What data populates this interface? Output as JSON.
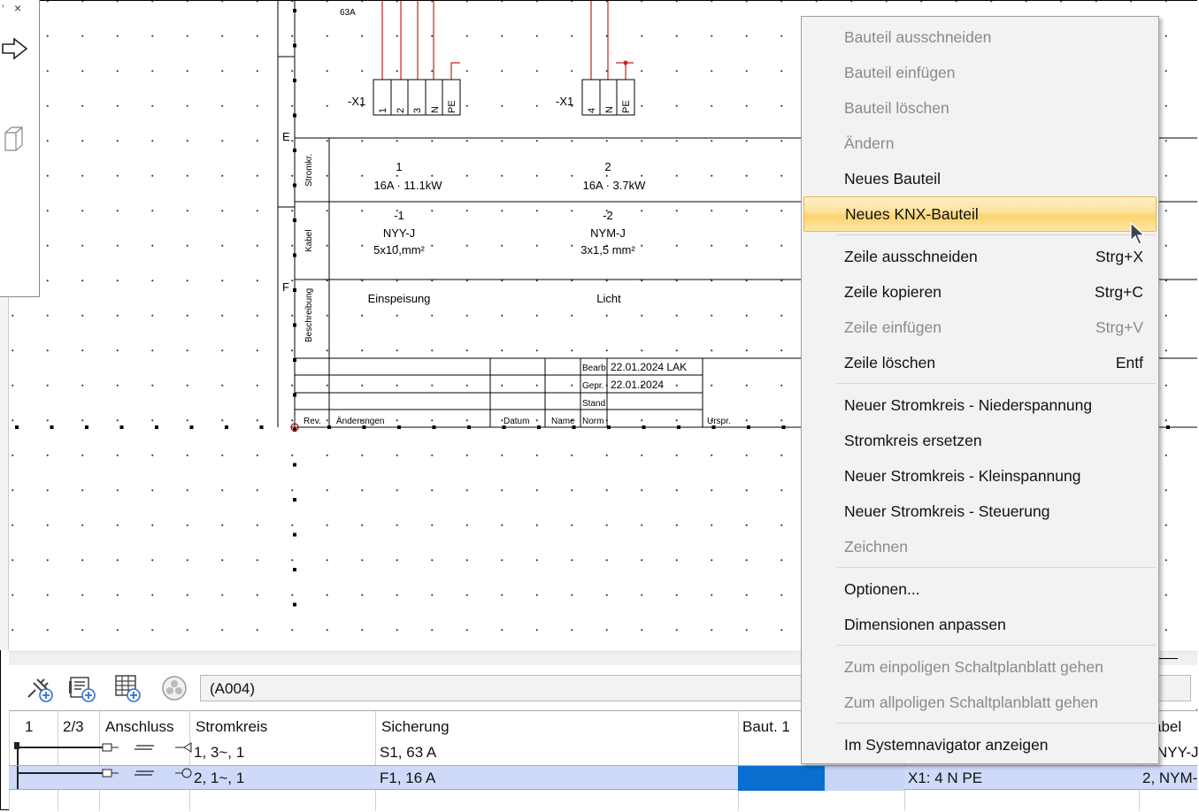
{
  "left_panel": {
    "close_glyph": "×",
    "icons": [
      "arrow-right-icon",
      "cube-icon"
    ]
  },
  "schematic": {
    "top_label": "63A",
    "terminals": [
      {
        "label": "-X1",
        "pins": [
          "1",
          "2",
          "3",
          "N",
          "PE"
        ]
      },
      {
        "label": "-X1",
        "pins": [
          "4",
          "N",
          "PE"
        ]
      }
    ],
    "row_letters": [
      "E",
      "F"
    ],
    "row_headers": [
      "Stromkr.",
      "Kabel",
      "Beschreibung"
    ],
    "circuits": [
      {
        "number": "1",
        "rating": "16A · 11.1kW",
        "cable_id": "-1",
        "cable_type": "NYY-J",
        "cable_size": "5x10,mm²",
        "description": "Einspeisung"
      },
      {
        "number": "2",
        "rating": "16A · 3.7kW",
        "cable_id": "-2",
        "cable_type": "NYM-J",
        "cable_size": "3x1,5 mm²",
        "description": "Licht"
      }
    ],
    "title_block": {
      "bearb_label": "Bearb.",
      "bearb_value": "22.01.2024 LAK",
      "gepr_label": "Gepr.",
      "gepr_value": "22.01.2024",
      "stand_label": "Stand",
      "rev": "Rev.",
      "changes": "Änderungen",
      "date": "Datum",
      "name": "Name",
      "norm": "Norm",
      "origin": "Urspr."
    }
  },
  "toolbar": {
    "icons": [
      "add-component-icon",
      "add-device-icon",
      "add-table-icon",
      "knx-icon"
    ],
    "address": "(A004)"
  },
  "table": {
    "headers": [
      "1",
      "2/3",
      "Anschluss",
      "Stromkreis",
      "Sicherung",
      "Baut. 1",
      "abel"
    ],
    "rows": [
      {
        "circuit": "1, 3~, 1",
        "fuse": "S1, 63 A",
        "terminal": "",
        "cable": "NYY-J"
      },
      {
        "circuit": "2, 1~, 1",
        "fuse": "F1, 16 A",
        "terminal": "X1: 4 N PE",
        "cable": "2, NYM-"
      }
    ]
  },
  "context_menu": {
    "items": [
      {
        "label": "Bauteil ausschneiden",
        "enabled": false
      },
      {
        "label": "Bauteil einfügen",
        "enabled": false
      },
      {
        "label": "Bauteil löschen",
        "enabled": false
      },
      {
        "label": "Ändern",
        "enabled": false
      },
      {
        "label": "Neues Bauteil",
        "enabled": true
      },
      {
        "label": "Neues KNX-Bauteil",
        "enabled": true,
        "highlighted": true
      },
      {
        "label": "Zeile ausschneiden",
        "shortcut": "Strg+X",
        "enabled": true
      },
      {
        "label": "Zeile kopieren",
        "shortcut": "Strg+C",
        "enabled": true
      },
      {
        "label": "Zeile einfügen",
        "shortcut": "Strg+V",
        "enabled": false
      },
      {
        "label": "Zeile löschen",
        "shortcut": "Entf",
        "enabled": true
      },
      {
        "label": "Neuer Stromkreis - Niederspannung",
        "enabled": true
      },
      {
        "label": "Stromkreis ersetzen",
        "enabled": true
      },
      {
        "label": "Neuer Stromkreis - Kleinspannung",
        "enabled": true
      },
      {
        "label": "Neuer Stromkreis - Steuerung",
        "enabled": true
      },
      {
        "label": "Zeichnen",
        "enabled": false
      },
      {
        "label": "Optionen...",
        "enabled": true
      },
      {
        "label": "Dimensionen anpassen",
        "enabled": true
      },
      {
        "label": "Zum einpoligen Schaltplanblatt gehen",
        "enabled": false
      },
      {
        "label": "Zum allpoligen Schaltplanblatt gehen",
        "enabled": false
      },
      {
        "label": "Im Systemnavigator anzeigen",
        "enabled": true
      }
    ]
  },
  "colors": {
    "wire_red": "#cc1f1f",
    "selection_blue": "#0a6ed1",
    "row_selected": "#cfd9f8",
    "menu_highlight": "#fde19a"
  }
}
